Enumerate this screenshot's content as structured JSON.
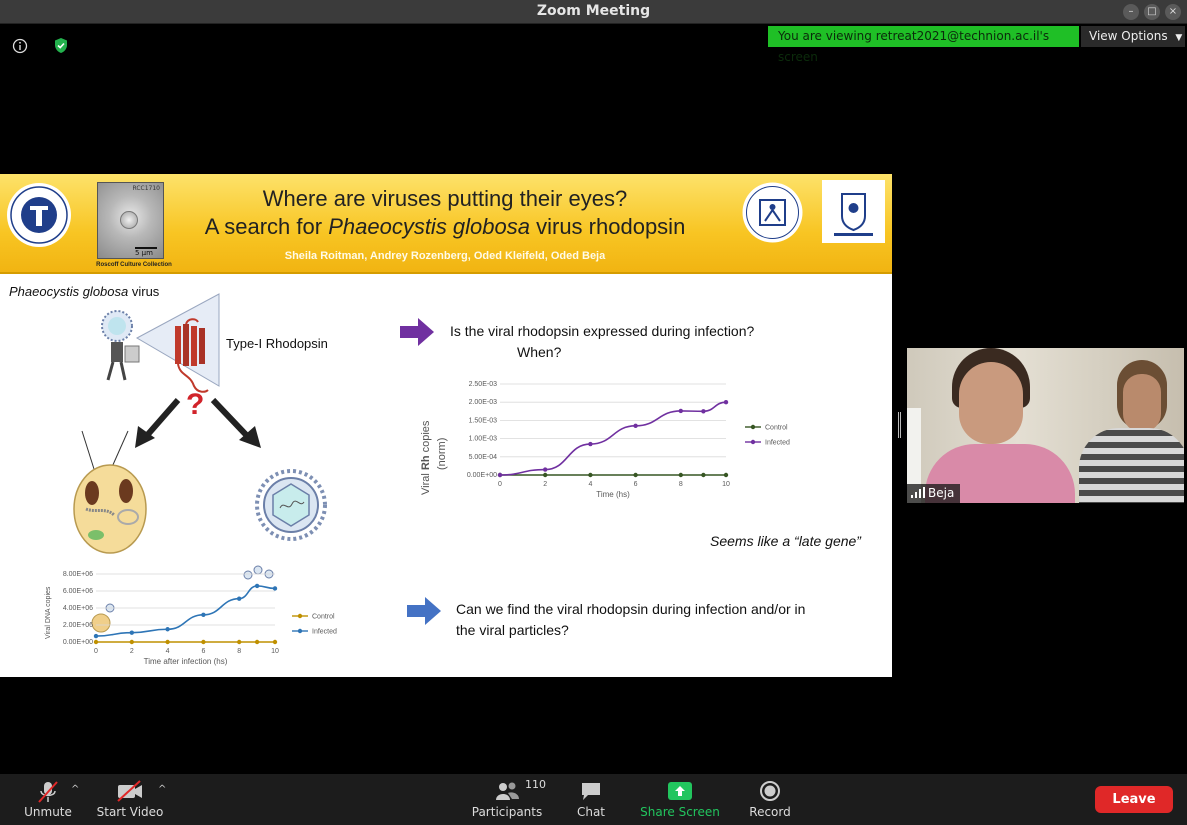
{
  "window": {
    "title": "Zoom Meeting",
    "controls": [
      "minimize-icon",
      "maximize-icon",
      "close-icon"
    ]
  },
  "topbar": {
    "banner_text": "You are viewing retreat2021@technion.ac.il's screen",
    "view_options_label": "View Options",
    "colors": {
      "banner": "#1fbf26",
      "toolbar": "#1c1c1c",
      "leave": "#e02828"
    }
  },
  "slide": {
    "title_line1": "Where are viruses putting their eyes?",
    "title_line2_prefix": "A search for ",
    "title_line2_species": "Phaeocystis globosa",
    "title_line2_suffix": " virus rhodopsin",
    "authors": "Sheila Roitman, Andrey Rozenberg, Oded Kleifeld, Oded Beja",
    "culture_caption": "Roscoff Culture Collection",
    "scale_bar": "5 µm",
    "image_id": "RCC1710",
    "virus_label_species": "Phaeocystis globosa",
    "virus_label_suffix": " virus",
    "rhodopsin_label": "Type-I Rhodopsin",
    "question_mark": "?",
    "question1_line1": "Is the viral rhodopsin expressed during infection?",
    "question1_line2": "When?",
    "late_gene_note": "Seems like a “late gene”",
    "question2_line1": "Can we find the viral rhodopsin during infection and/or in",
    "question2_line2": "the viral particles?"
  },
  "chart_data": [
    {
      "type": "line",
      "ylabel_pre": "Viral",
      "ylabel_bold": "Rh",
      "ylabel_post": "copies",
      "ylabel_line2": "(norm)",
      "xlabel": "Time (hs)",
      "x_ticks": [
        "0",
        "2",
        "4",
        "6",
        "8",
        "10"
      ],
      "y_ticks": [
        "0.00E+00",
        "5.00E-04",
        "1.00E-03",
        "1.50E-03",
        "2.00E-03",
        "2.50E-03"
      ],
      "xlim": [
        0,
        10
      ],
      "ylim": [
        0,
        0.0025
      ],
      "series": [
        {
          "name": "Control",
          "color": "#375623",
          "x": [
            0,
            2,
            4,
            6,
            8,
            9,
            10
          ],
          "values": [
            0,
            0,
            0,
            0,
            0,
            0,
            0
          ]
        },
        {
          "name": "Infected",
          "color": "#7030a0",
          "x": [
            0,
            2,
            4,
            6,
            8,
            9,
            10
          ],
          "values": [
            0,
            0.00015,
            0.00085,
            0.00135,
            0.00176,
            0.00175,
            0.002
          ]
        }
      ]
    },
    {
      "type": "line",
      "ylabel": "Viral DNA copies",
      "xlabel": "Time after infection (hs)",
      "x_ticks": [
        "0",
        "2",
        "4",
        "6",
        "8",
        "10"
      ],
      "y_ticks": [
        "0.00E+00",
        "2.00E+06",
        "4.00E+06",
        "6.00E+06",
        "8.00E+06"
      ],
      "xlim": [
        0,
        10
      ],
      "ylim": [
        0,
        8000000
      ],
      "series": [
        {
          "name": "Control",
          "color": "#bf9000",
          "x": [
            0,
            2,
            4,
            6,
            8,
            9,
            10
          ],
          "values": [
            0,
            0,
            0,
            0,
            0,
            0,
            0
          ]
        },
        {
          "name": "Infected",
          "color": "#2e75b6",
          "x": [
            0,
            2,
            4,
            6,
            8,
            9,
            10
          ],
          "values": [
            700000,
            1100000,
            1500000,
            3200000,
            5100000,
            6600000,
            6300000
          ]
        }
      ]
    }
  ],
  "participant": {
    "name": "Beja"
  },
  "toolbar": {
    "unmute_label": "Unmute",
    "start_video_label": "Start Video",
    "participants_label": "Participants",
    "participants_count": "110",
    "chat_label": "Chat",
    "share_screen_label": "Share Screen",
    "record_label": "Record",
    "leave_label": "Leave"
  }
}
